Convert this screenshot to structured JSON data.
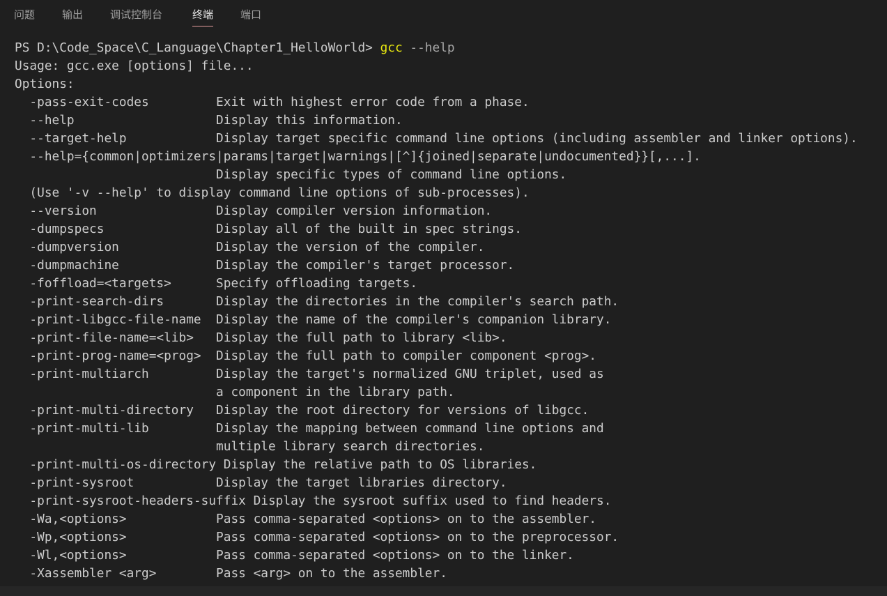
{
  "tabs": [
    {
      "id": "problems",
      "label": "问题"
    },
    {
      "id": "output",
      "label": "输出"
    },
    {
      "id": "debug-console",
      "label": "调试控制台"
    },
    {
      "id": "terminal",
      "label": "终端",
      "active": true
    },
    {
      "id": "ports",
      "label": "端口"
    }
  ],
  "colors": {
    "background": "#1f1f1f",
    "text": "#cccccc",
    "command": "#e5e510",
    "argument": "#a7a7a7",
    "active_tab_underline": "#e8a0a0"
  },
  "terminal": {
    "prompt": "PS D:\\Code_Space\\C_Language\\Chapter1_HelloWorld> ",
    "command": "gcc",
    "args": " --help",
    "lines": [
      "Usage: gcc.exe [options] file...",
      "Options:",
      "  -pass-exit-codes         Exit with highest error code from a phase.",
      "  --help                   Display this information.",
      "  --target-help            Display target specific command line options (including assembler and linker options).",
      "  --help={common|optimizers|params|target|warnings|[^]{joined|separate|undocumented}}[,...].",
      "                           Display specific types of command line options.",
      "  (Use '-v --help' to display command line options of sub-processes).",
      "  --version                Display compiler version information.",
      "  -dumpspecs               Display all of the built in spec strings.",
      "  -dumpversion             Display the version of the compiler.",
      "  -dumpmachine             Display the compiler's target processor.",
      "  -foffload=<targets>      Specify offloading targets.",
      "  -print-search-dirs       Display the directories in the compiler's search path.",
      "  -print-libgcc-file-name  Display the name of the compiler's companion library.",
      "  -print-file-name=<lib>   Display the full path to library <lib>.",
      "  -print-prog-name=<prog>  Display the full path to compiler component <prog>.",
      "  -print-multiarch         Display the target's normalized GNU triplet, used as",
      "                           a component in the library path.",
      "  -print-multi-directory   Display the root directory for versions of libgcc.",
      "  -print-multi-lib         Display the mapping between command line options and",
      "                           multiple library search directories.",
      "  -print-multi-os-directory Display the relative path to OS libraries.",
      "  -print-sysroot           Display the target libraries directory.",
      "  -print-sysroot-headers-suffix Display the sysroot suffix used to find headers.",
      "  -Wa,<options>            Pass comma-separated <options> on to the assembler.",
      "  -Wp,<options>            Pass comma-separated <options> on to the preprocessor.",
      "  -Wl,<options>            Pass comma-separated <options> on to the linker.",
      "  -Xassembler <arg>        Pass <arg> on to the assembler."
    ]
  }
}
